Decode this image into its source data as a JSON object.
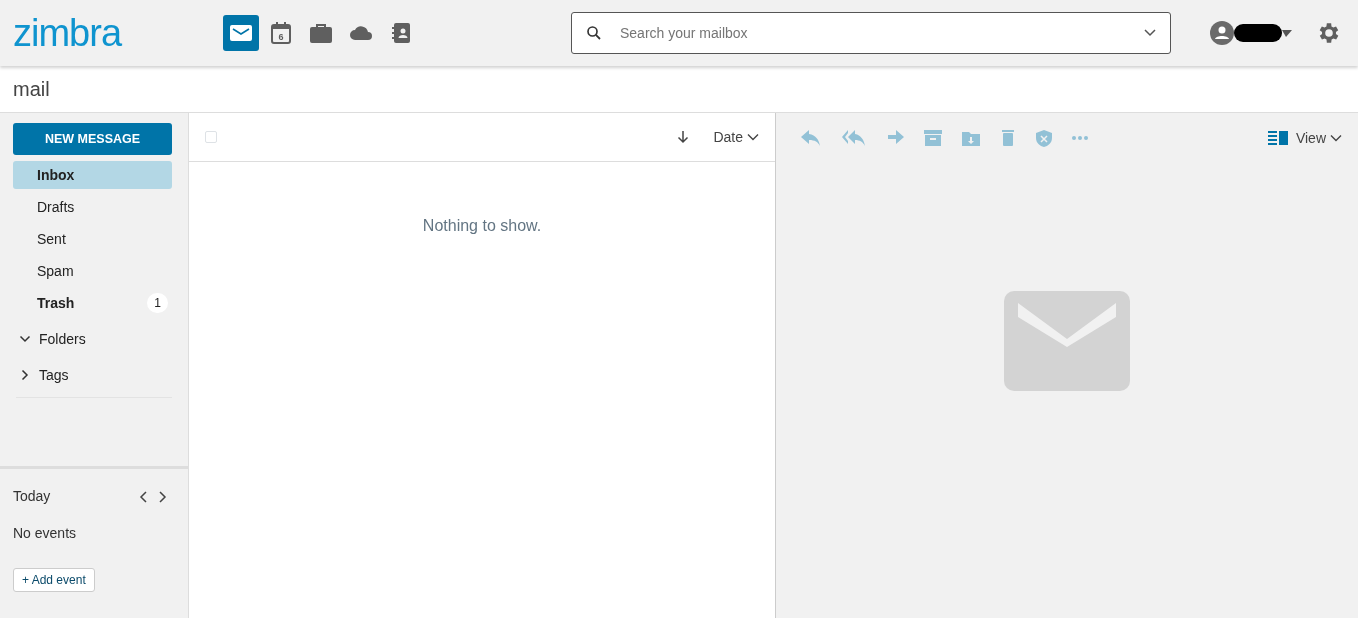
{
  "logo": "zimbra",
  "apps": [
    {
      "kind": "mail",
      "selected": true
    },
    {
      "kind": "calendar",
      "label": "6",
      "selected": false
    },
    {
      "kind": "briefcase",
      "selected": false
    },
    {
      "kind": "cloud",
      "selected": false
    },
    {
      "kind": "contacts",
      "selected": false
    }
  ],
  "search": {
    "placeholder": "Search your mailbox"
  },
  "page_title": "mail",
  "new_message": "NEW MESSAGE",
  "folders": [
    {
      "name": "Inbox",
      "selected": true,
      "unread": true
    },
    {
      "name": "Drafts",
      "selected": false,
      "unread": false
    },
    {
      "name": "Sent",
      "selected": false,
      "unread": false
    },
    {
      "name": "Spam",
      "selected": false,
      "unread": false
    },
    {
      "name": "Trash",
      "selected": false,
      "unread": true,
      "count": "1"
    }
  ],
  "groups": [
    {
      "name": "Folders",
      "expanded": true
    },
    {
      "name": "Tags",
      "expanded": false
    }
  ],
  "calendar": {
    "title": "Today",
    "empty": "No events",
    "add": "+ Add event"
  },
  "list": {
    "sort": "Date",
    "empty": "Nothing to show."
  },
  "select_all": {
    "checked": false
  },
  "toolbar": [
    {
      "kind": "reply"
    },
    {
      "kind": "reply-all"
    },
    {
      "kind": "forward"
    },
    {
      "kind": "archive"
    },
    {
      "kind": "move"
    },
    {
      "kind": "delete"
    },
    {
      "kind": "spam"
    },
    {
      "kind": "more"
    }
  ],
  "view": "View"
}
